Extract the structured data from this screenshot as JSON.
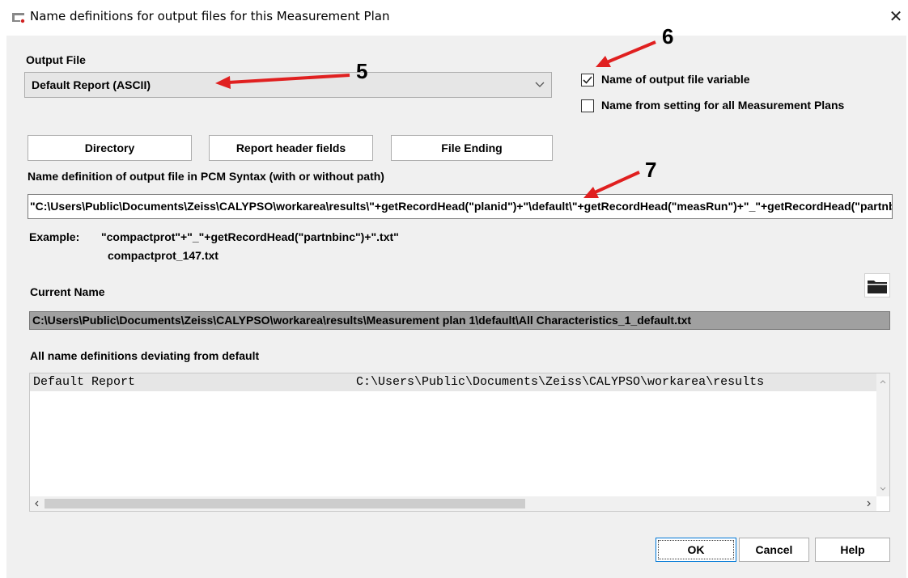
{
  "window": {
    "title": "Name definitions for output files for this Measurement Plan",
    "close": "✕"
  },
  "output_file": {
    "label": "Output File",
    "value": "Default Report  (ASCII)"
  },
  "checkboxes": [
    {
      "label": "Name of output file variable",
      "checked": true
    },
    {
      "label": "Name from setting for all Measurement Plans",
      "checked": false
    }
  ],
  "buttons": {
    "directory": "Directory",
    "report_header": "Report header fields",
    "file_ending": "File Ending",
    "ok": "OK",
    "cancel": "Cancel",
    "help": "Help"
  },
  "syntax": {
    "label": "Name definition of output file in PCM Syntax (with or without path)",
    "value": "\"C:\\Users\\Public\\Documents\\Zeiss\\CALYPSO\\workarea\\results\\\"+getRecordHead(\"planid\")+\"\\default\\\"+getRecordHead(\"measRun\")+\"_\"+getRecordHead(\"partnbinc\")+\".txt\""
  },
  "example": {
    "label": "Example:",
    "syntax": "\"compactprot\"+\"_\"+getRecordHead(\"partnbinc\")+\".txt\"",
    "result": "compactprot_147.txt"
  },
  "current": {
    "label": "Current Name",
    "value": "C:\\Users\\Public\\Documents\\Zeiss\\CALYPSO\\workarea\\results\\Measurement plan 1\\default\\All Characteristics_1_default.txt"
  },
  "deviating": {
    "label": "All name definitions deviating from default",
    "rows": [
      {
        "name": "Default Report",
        "path": "C:\\Users\\Public\\Documents\\Zeiss\\CALYPSO\\workarea\\results"
      }
    ]
  },
  "annotations": [
    "5",
    "6",
    "7"
  ],
  "colors": {
    "arrow": "#e02020",
    "dialog_bg": "#f0f0f0",
    "selected_row": "#e6e6e6",
    "current_name_bg": "#a0a0a0"
  }
}
